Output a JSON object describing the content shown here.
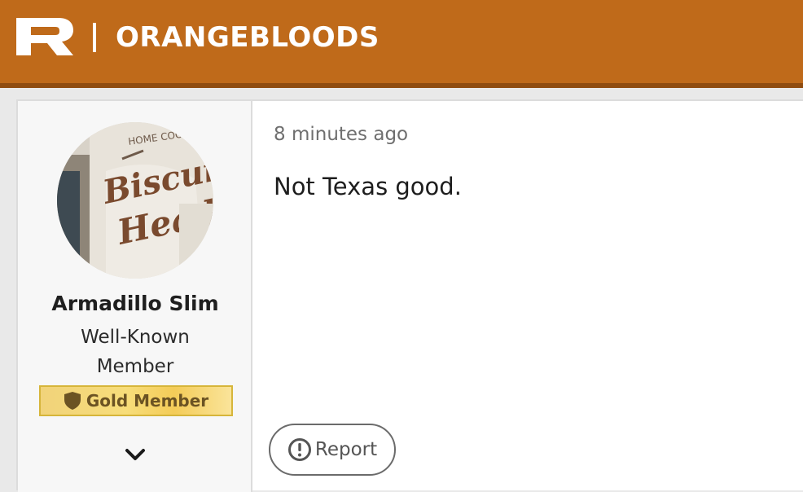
{
  "header": {
    "logo_icon": "rivals-r-logo-icon",
    "site_name": "ORANGEBLOODS",
    "background_color": "#bf6a1a"
  },
  "post": {
    "author": {
      "avatar": "avatar-image",
      "name": "Armadillo Slim",
      "title": "Well-Known Member",
      "badge": {
        "icon": "shield-icon",
        "label": "Gold Member"
      },
      "expand_icon": "chevron-down-icon"
    },
    "timestamp": "8 minutes ago",
    "message": "Not Texas good.",
    "report": {
      "icon": "exclamation-circle-icon",
      "label": "Report"
    }
  }
}
